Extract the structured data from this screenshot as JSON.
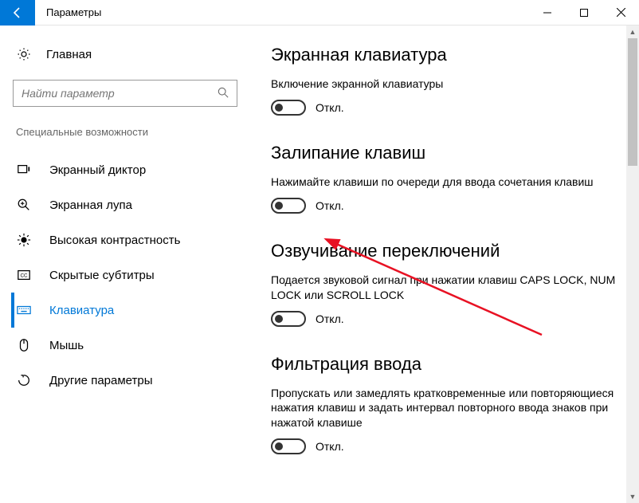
{
  "titlebar": {
    "title": "Параметры"
  },
  "sidebar": {
    "home": "Главная",
    "search_placeholder": "Найти параметр",
    "section": "Специальные возможности",
    "items": [
      {
        "label": "Экранный диктор"
      },
      {
        "label": "Экранная лупа"
      },
      {
        "label": "Высокая контрастность"
      },
      {
        "label": "Скрытые субтитры"
      },
      {
        "label": "Клавиатура"
      },
      {
        "label": "Мышь"
      },
      {
        "label": "Другие параметры"
      }
    ]
  },
  "content": {
    "sec1": {
      "heading": "Экранная клавиатура",
      "desc": "Включение экранной клавиатуры",
      "state": "Откл."
    },
    "sec2": {
      "heading": "Залипание клавиш",
      "desc": "Нажимайте клавиши по очереди для ввода сочетания клавиш",
      "state": "Откл."
    },
    "sec3": {
      "heading": "Озвучивание переключений",
      "desc": "Подается звуковой сигнал при нажатии клавиш CAPS LOCK, NUM LOCK или SCROLL LOCK",
      "state": "Откл."
    },
    "sec4": {
      "heading": "Фильтрация ввода",
      "desc": "Пропускать или замедлять кратковременные или повторяющиеся нажатия клавиш и задать интервал повторного ввода знаков при нажатой клавише",
      "state": "Откл."
    }
  }
}
